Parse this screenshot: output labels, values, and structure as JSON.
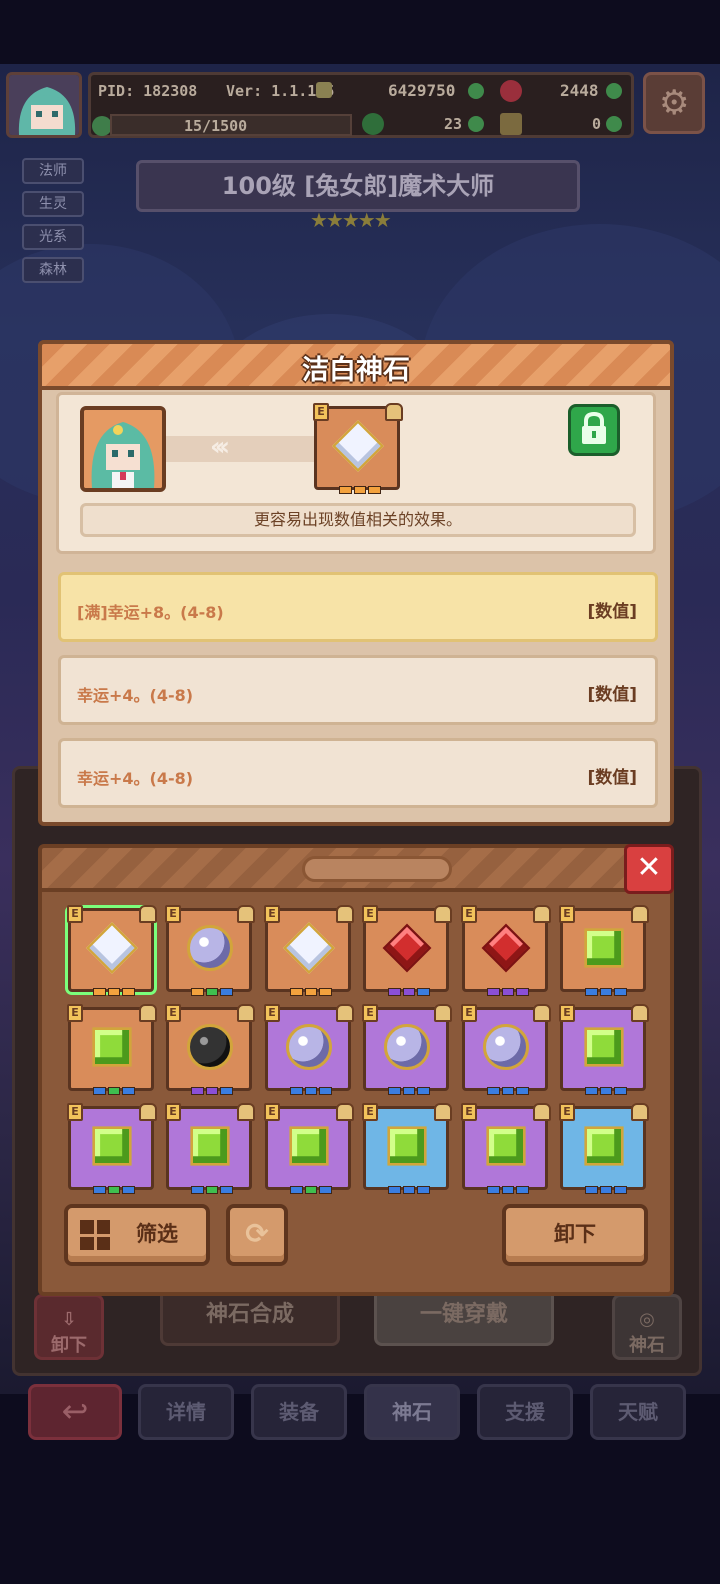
{
  "player": {
    "pid": "PID: 182308",
    "version": "Ver: 1.1.1.5",
    "gold": "6429750",
    "gems": "2448",
    "stamina": "15/1500",
    "clover": "23",
    "keys": "0"
  },
  "hero": {
    "tags": [
      "法师",
      "生灵",
      "光系",
      "森林"
    ],
    "title": "100级  [兔女郎]魔术大师",
    "stars": "★★★★★"
  },
  "detail": {
    "title": "洁白神石",
    "arrows": "‹‹‹",
    "description": "更容易出现数值相关的效果。",
    "stats": [
      {
        "text": "[满]幸运+8。(4-8)",
        "type": "[数值]"
      },
      {
        "text": "幸运+4。(4-8)",
        "type": "[数值]"
      },
      {
        "text": "幸运+4。(4-8)",
        "type": "[数值]"
      }
    ]
  },
  "gem_list": {
    "close_label": "✕",
    "grade_label": "E",
    "filter_label": "筛选",
    "unequip_label": "卸下",
    "gems": [
      {
        "frame": "orange",
        "kind": "diamond",
        "dots": [
          "#f3a23e",
          "#f3a23e",
          "#f3a23e"
        ]
      },
      {
        "frame": "orange",
        "kind": "sphere",
        "dots": [
          "#f3a23e",
          "#3fbf4f",
          "#3a7de0"
        ]
      },
      {
        "frame": "orange",
        "kind": "diamond",
        "dots": [
          "#f3a23e",
          "#f3a23e",
          "#f3a23e"
        ]
      },
      {
        "frame": "orange",
        "kind": "ruby",
        "dots": [
          "#8a4fd6",
          "#8a4fd6",
          "#3a7de0"
        ]
      },
      {
        "frame": "orange",
        "kind": "ruby",
        "dots": [
          "#8a4fd6",
          "#8a4fd6",
          "#8a4fd6"
        ]
      },
      {
        "frame": "orange",
        "kind": "emerald",
        "dots": [
          "#3a7de0",
          "#3a7de0",
          "#3a7de0"
        ]
      },
      {
        "frame": "orange",
        "kind": "emerald",
        "dots": [
          "#3a7de0",
          "#3fbf4f",
          "#3a7de0"
        ]
      },
      {
        "frame": "orange",
        "kind": "black",
        "dots": [
          "#8a4fd6",
          "#8a4fd6",
          "#3a7de0"
        ]
      },
      {
        "frame": "purple",
        "kind": "sphere",
        "dots": [
          "#3a7de0",
          "#3a7de0",
          "#3a7de0"
        ]
      },
      {
        "frame": "purple",
        "kind": "sphere",
        "dots": [
          "#3a7de0",
          "#3a7de0",
          "#3a7de0"
        ]
      },
      {
        "frame": "purple",
        "kind": "sphere",
        "dots": [
          "#3a7de0",
          "#3a7de0",
          "#3a7de0"
        ]
      },
      {
        "frame": "purple",
        "kind": "emerald",
        "dots": [
          "#3a7de0",
          "#3a7de0",
          "#3a7de0"
        ]
      },
      {
        "frame": "purple",
        "kind": "emerald",
        "dots": [
          "#3a7de0",
          "#3fbf4f",
          "#3a7de0"
        ]
      },
      {
        "frame": "purple",
        "kind": "emerald",
        "dots": [
          "#3a7de0",
          "#3fbf4f",
          "#3a7de0"
        ]
      },
      {
        "frame": "purple",
        "kind": "emerald",
        "dots": [
          "#3a7de0",
          "#3fbf4f",
          "#3a7de0"
        ]
      },
      {
        "frame": "blue",
        "kind": "emerald",
        "dots": [
          "#3a7de0",
          "#3a7de0",
          "#3a7de0"
        ]
      },
      {
        "frame": "purple",
        "kind": "emerald",
        "dots": [
          "#3a7de0",
          "#3a7de0",
          "#3a7de0"
        ]
      },
      {
        "frame": "blue",
        "kind": "emerald",
        "dots": [
          "#3a7de0",
          "#3a7de0",
          "#3a7de0"
        ]
      }
    ],
    "selected_index": 0
  },
  "background_ui": {
    "left_button": "卸下",
    "right_button": "神石",
    "compose_label": "神石合成",
    "equip_all_label": "一键穿戴"
  },
  "tabs": [
    "详情",
    "装备",
    "神石",
    "支援",
    "天赋"
  ],
  "active_tab": 2
}
